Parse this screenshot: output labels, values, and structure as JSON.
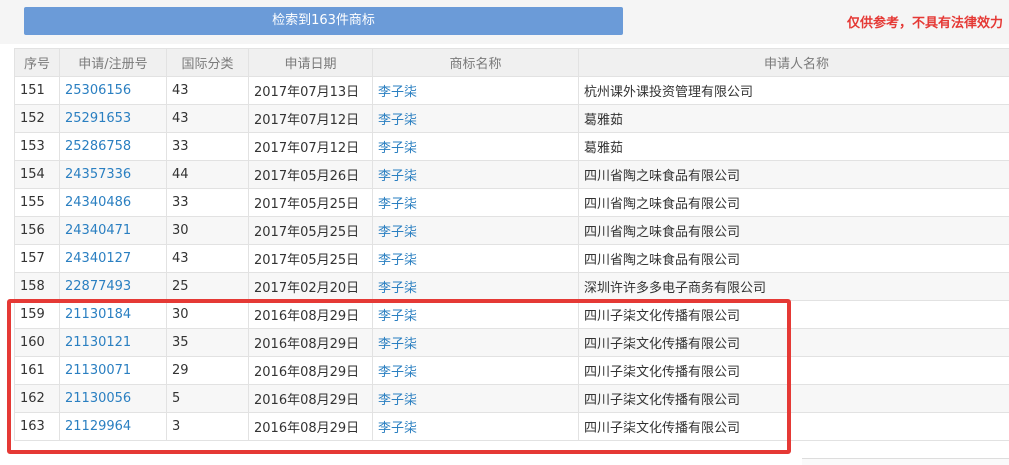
{
  "banner": {
    "label": "检索到163件商标"
  },
  "disclaimer": "仅供参考，不具有法律效力",
  "table": {
    "headers": [
      "序号",
      "申请/注册号",
      "国际分类",
      "申请日期",
      "商标名称",
      "申请人名称"
    ],
    "rows": [
      [
        "151",
        "25306156",
        "43",
        "2017年07月13日",
        "李子柒",
        "杭州课外课投资管理有限公司"
      ],
      [
        "152",
        "25291653",
        "43",
        "2017年07月12日",
        "李子柒",
        "葛雅茹"
      ],
      [
        "153",
        "25286758",
        "33",
        "2017年07月12日",
        "李子柒",
        "葛雅茹"
      ],
      [
        "154",
        "24357336",
        "44",
        "2017年05月26日",
        "李子柒",
        "四川省陶之味食品有限公司"
      ],
      [
        "155",
        "24340486",
        "33",
        "2017年05月25日",
        "李子柒",
        "四川省陶之味食品有限公司"
      ],
      [
        "156",
        "24340471",
        "30",
        "2017年05月25日",
        "李子柒",
        "四川省陶之味食品有限公司"
      ],
      [
        "157",
        "24340127",
        "43",
        "2017年05月25日",
        "李子柒",
        "四川省陶之味食品有限公司"
      ],
      [
        "158",
        "22877493",
        "25",
        "2017年02月20日",
        "李子柒",
        "深圳许许多多电子商务有限公司"
      ],
      [
        "159",
        "21130184",
        "30",
        "2016年08月29日",
        "李子柒",
        "四川子柒文化传播有限公司"
      ],
      [
        "160",
        "21130121",
        "35",
        "2016年08月29日",
        "李子柒",
        "四川子柒文化传播有限公司"
      ],
      [
        "161",
        "21130071",
        "29",
        "2016年08月29日",
        "李子柒",
        "四川子柒文化传播有限公司"
      ],
      [
        "162",
        "21130056",
        "5",
        "2016年08月29日",
        "李子柒",
        "四川子柒文化传播有限公司"
      ],
      [
        "163",
        "21129964",
        "3",
        "2016年08月29日",
        "李子柒",
        "四川子柒文化传播有限公司"
      ]
    ]
  },
  "colors": {
    "accent": "#6b9bd8",
    "link": "#2a7fc1",
    "alert": "#e53935"
  }
}
